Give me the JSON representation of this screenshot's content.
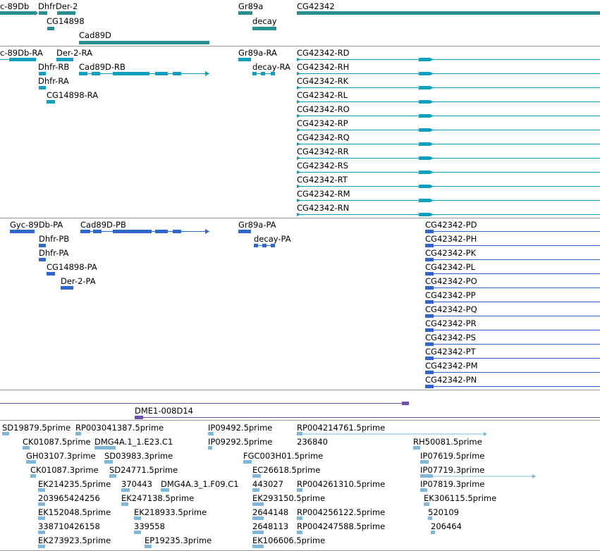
{
  "colors": {
    "gene": "#2a8f8f",
    "transcript_cyan": "#0f9fbf",
    "transcript_blue": "#2f67cf",
    "clone": "#6b4fa8",
    "est": "#7fb8d8",
    "divider": "#9a9a9a"
  },
  "tracks": {
    "genes": [
      "c-89Db",
      "DhfrDer-2",
      "CG14898",
      "Cad89D",
      "Gr89a",
      "decay",
      "CG42342"
    ],
    "transcripts_a": [
      "c-89Db-RA",
      "Der-2-RA",
      "Dhfr-RB",
      "Cad89D-RB",
      "Dhfr-RA",
      "CG14898-RA",
      "Gr89a-RA",
      "decay-RA",
      "CG42342-RD",
      "CG42342-RH",
      "CG42342-RK",
      "CG42342-RL",
      "CG42342-RO",
      "CG42342-RP",
      "CG42342-RQ",
      "CG42342-RR",
      "CG42342-RS",
      "CG42342-RT",
      "CG42342-RM",
      "CG42342-RN"
    ],
    "transcripts_b": [
      "Gyc-89Db-PA",
      "Cad89D-PB",
      "Dhfr-PB",
      "Dhfr-PA",
      "CG14898-PA",
      "Der-2-PA",
      "Gr89a-PA",
      "decay-PA",
      "CG42342-PD",
      "CG42342-PH",
      "CG42342-PK",
      "CG42342-PL",
      "CG42342-PO",
      "CG42342-PP",
      "CG42342-PQ",
      "CG42342-PR",
      "CG42342-PS",
      "CG42342-PT",
      "CG42342-PM",
      "CG42342-PN"
    ],
    "clones": [
      "DME1-008D14"
    ],
    "ests": [
      "SD19879.5prime",
      "RP003041387.5prime",
      "IP09492.5prime",
      "RP004214761.5prime",
      "CK01087.5prime",
      "DMG4A.1_1.E23.C1",
      "IP09292.5prime",
      "236840",
      "RH50081.5prime",
      "GH03107.3prime",
      "SD03983.3prime",
      "FGC003H01.5prime",
      "IP07619.5prime",
      "CK01087.3prime",
      "SD24771.5prime",
      "EC26618.5prime",
      "IP07719.3prime",
      "EK214235.5prime",
      "370443",
      "DMG4A.3_1.F09.C1",
      "443027",
      "RP004261310.5prime",
      "IP07819.3prime",
      "203965424256",
      "EK247138.5prime",
      "EK293150.5prime",
      "EK306115.5prime",
      "EK152048.5prime",
      "EK218933.5prime",
      "2644148",
      "RP004256122.5prime",
      "520109",
      "338710426158",
      "339558",
      "2648113",
      "RP004247588.5prime",
      "206464",
      "EK273923.5prime",
      "EP19235.3prime",
      "EK106606.5prime"
    ]
  }
}
